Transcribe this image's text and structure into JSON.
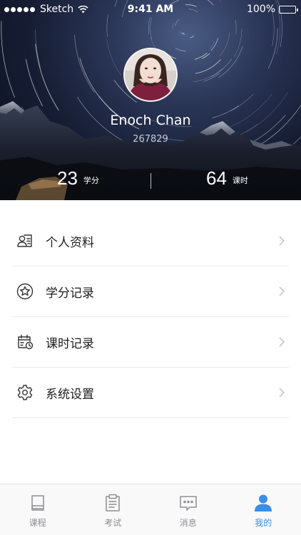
{
  "status_bar": {
    "carrier": "Sketch",
    "time": "9:41 AM",
    "battery": "100%",
    "battery_level": 1.0
  },
  "profile": {
    "name": "Enoch Chan",
    "id": "267829",
    "credits": {
      "value": "23",
      "unit": "学分"
    },
    "hours": {
      "value": "64",
      "unit": "课时"
    }
  },
  "menu": {
    "items": [
      {
        "label": "个人资料",
        "icon": "profile-card-icon"
      },
      {
        "label": "学分记录",
        "icon": "star-circle-icon"
      },
      {
        "label": "课时记录",
        "icon": "calendar-clock-icon"
      },
      {
        "label": "系统设置",
        "icon": "gear-icon"
      }
    ]
  },
  "tabbar": {
    "active_color": "#3a8ee6",
    "inactive_color": "#8e8e93",
    "tabs": [
      {
        "label": "课程",
        "icon": "book-icon",
        "active": false
      },
      {
        "label": "考试",
        "icon": "clipboard-icon",
        "active": false
      },
      {
        "label": "消息",
        "icon": "chat-bubble-icon",
        "active": false
      },
      {
        "label": "我的",
        "icon": "person-icon",
        "active": true
      }
    ]
  }
}
